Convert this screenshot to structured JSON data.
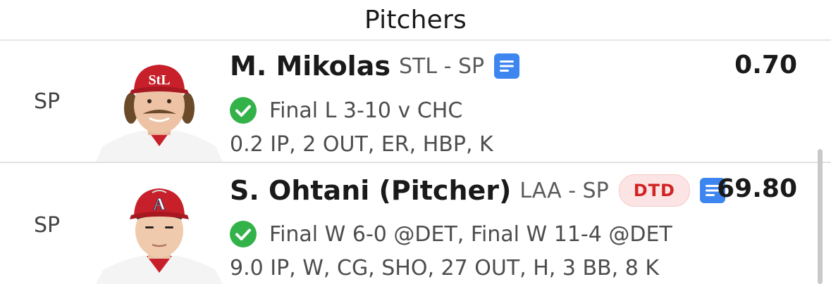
{
  "section": {
    "title": "Pitchers"
  },
  "players": [
    {
      "position": "SP",
      "name": "M. Mikolas",
      "team_pos": "STL - SP",
      "badge": "",
      "game": "Final L 3-10 v CHC",
      "stats": "0.2 IP, 2 OUT, ER, HBP, K",
      "points": "0.70",
      "avatar_icon": "player-photo-cardinals"
    },
    {
      "position": "SP",
      "name": "S. Ohtani (Pitcher)",
      "team_pos": "LAA - SP",
      "badge": "DTD",
      "game": "Final W 6-0 @DET, Final W 11-4 @DET",
      "stats": "9.0 IP, W, CG, SHO, 27 OUT, H, 3 BB, 8 K",
      "points": "69.80",
      "avatar_icon": "player-photo-angels"
    }
  ],
  "colors": {
    "check_green": "#34b24a",
    "notes_blue": "#3d86f0",
    "dtd_red": "#d12424",
    "jersey_red": "#c8202a"
  }
}
